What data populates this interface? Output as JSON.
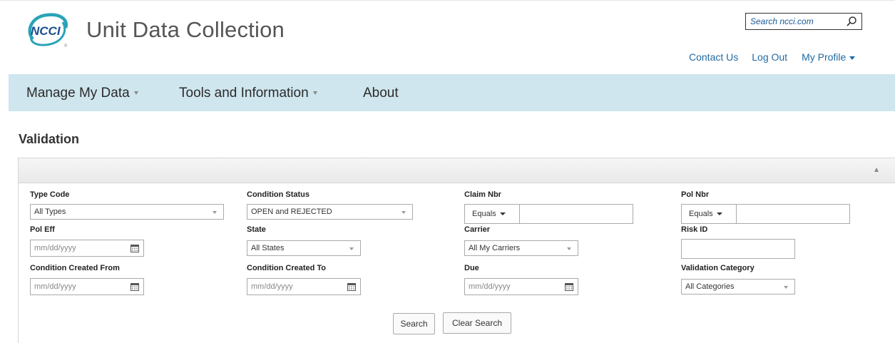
{
  "header": {
    "app_title": "Unit Data Collection",
    "logo_text": "NCCI",
    "search_placeholder": "Search ncci.com",
    "links": {
      "contact": "Contact Us",
      "logout": "Log Out",
      "profile": "My Profile"
    }
  },
  "nav": {
    "items": [
      "Manage My Data",
      "Tools and Information",
      "About"
    ]
  },
  "page": {
    "title": "Validation"
  },
  "form": {
    "type_code": {
      "label": "Type Code",
      "value": "All Types"
    },
    "condition_status": {
      "label": "Condition Status",
      "value": "OPEN and REJECTED"
    },
    "claim_nbr": {
      "label": "Claim Nbr",
      "operator": "Equals",
      "value": ""
    },
    "pol_nbr": {
      "label": "Pol Nbr",
      "operator": "Equals",
      "value": ""
    },
    "pol_eff": {
      "label": "Pol Eff",
      "placeholder": "mm/dd/yyyy"
    },
    "state": {
      "label": "State",
      "value": "All States"
    },
    "carrier": {
      "label": "Carrier",
      "value": "All My Carriers"
    },
    "risk_id": {
      "label": "Risk ID",
      "value": ""
    },
    "created_from": {
      "label": "Condition Created From",
      "placeholder": "mm/dd/yyyy"
    },
    "created_to": {
      "label": "Condition Created To",
      "placeholder": "mm/dd/yyyy"
    },
    "due": {
      "label": "Due",
      "placeholder": "mm/dd/yyyy"
    },
    "validation_category": {
      "label": "Validation Category",
      "value": "All Categories"
    },
    "buttons": {
      "search": "Search",
      "clear": "Clear Search"
    }
  },
  "colors": {
    "nav_bg": "#cfe6ee",
    "link": "#1f6aa5",
    "logo_teal": "#2aa3b8",
    "logo_blue": "#1a4f8c"
  }
}
